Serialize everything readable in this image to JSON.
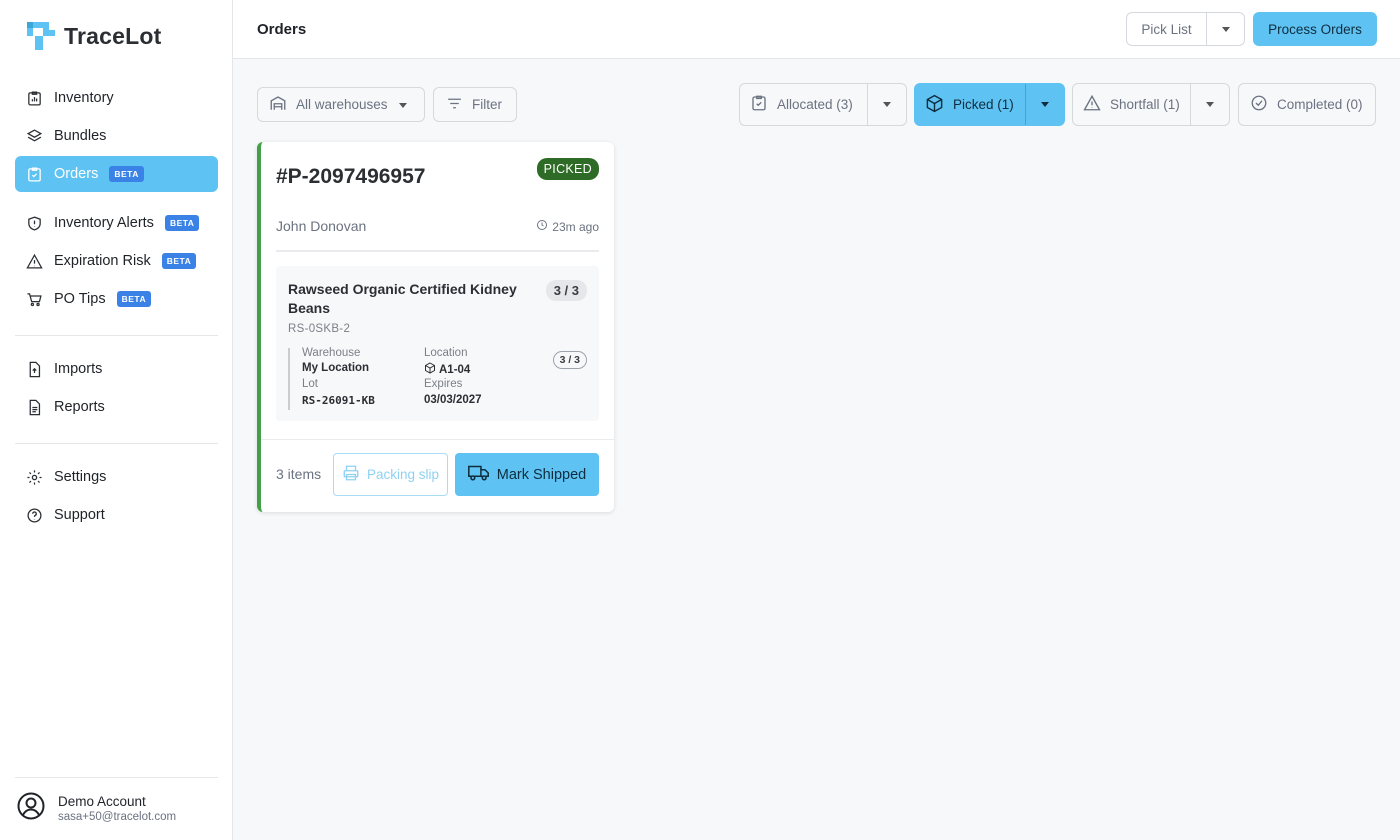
{
  "app": {
    "name": "TraceLot"
  },
  "sidebar": {
    "items": [
      {
        "label": "Inventory",
        "icon": "chart-clipboard-icon"
      },
      {
        "label": "Bundles",
        "icon": "layers-icon"
      },
      {
        "label": "Orders",
        "icon": "clipboard-check-icon",
        "badge": "BETA",
        "active": true
      },
      {
        "label": "Inventory Alerts",
        "icon": "shield-icon",
        "badge": "BETA"
      },
      {
        "label": "Expiration Risk",
        "icon": "warning-icon",
        "badge": "BETA"
      },
      {
        "label": "PO Tips",
        "icon": "cart-icon",
        "badge": "BETA"
      },
      {
        "label": "Imports",
        "icon": "file-import-icon"
      },
      {
        "label": "Reports",
        "icon": "file-text-icon"
      },
      {
        "label": "Settings",
        "icon": "gear-icon"
      },
      {
        "label": "Support",
        "icon": "help-circle-icon"
      }
    ],
    "account": {
      "name": "Demo Account",
      "email": "sasa+50@tracelot.com"
    }
  },
  "header": {
    "title": "Orders",
    "pick_list_label": "Pick List",
    "process_label": "Process Orders"
  },
  "toolbar": {
    "warehouse_value": "All warehouses",
    "filter_label": "Filter",
    "statuses": [
      {
        "label": "Allocated (3)"
      },
      {
        "label": "Picked (1)",
        "active": true
      },
      {
        "label": "Shortfall (1)"
      },
      {
        "label": "Completed (0)"
      }
    ]
  },
  "order": {
    "id": "#P-2097496957",
    "status": "PICKED",
    "customer": "John Donovan",
    "time_ago": "23m ago",
    "line_item": {
      "product": "Rawseed Organic Certified Kidney Beans",
      "qty": "3 / 3",
      "sku": "RS-0SKB-2",
      "warehouse_label": "Warehouse",
      "warehouse": "My Location",
      "location_label": "Location",
      "location": "A1-04",
      "lot_label": "Lot",
      "lot": "RS-26091-KB",
      "expires_label": "Expires",
      "expires": "03/03/2027",
      "pick_qty": "3 / 3"
    },
    "items_count": "3 items",
    "packing_label": "Packing slip",
    "ship_label": "Mark Shipped"
  },
  "colors": {
    "accent": "#5ec3f2",
    "beta_badge": "#3b82e6",
    "picked_badge": "#2e6b26",
    "card_border": "#43a047"
  }
}
